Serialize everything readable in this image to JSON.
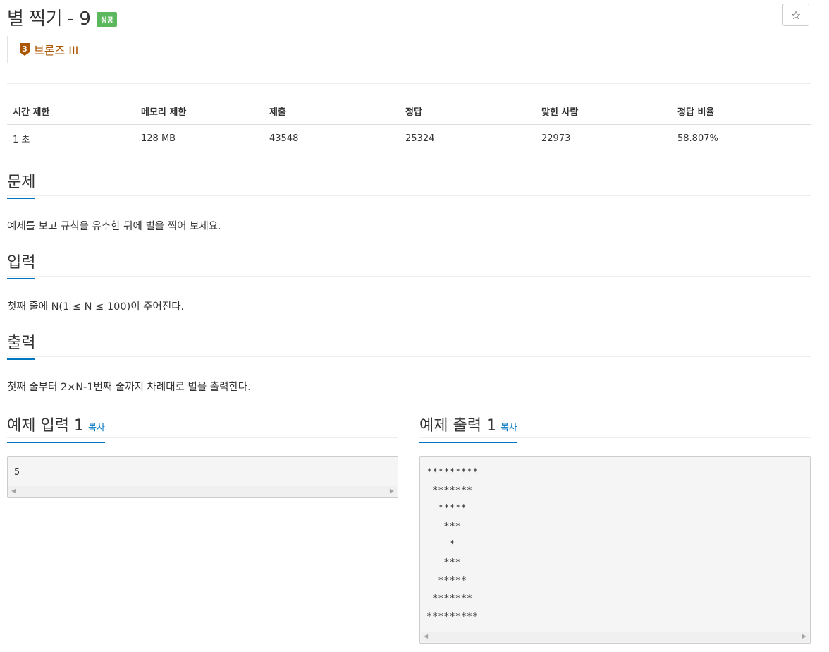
{
  "problem": {
    "title": "별 찍기 - 9",
    "status_badge": "성공",
    "star_glyph": "☆",
    "tier": {
      "number": "3",
      "label": "브론즈 III",
      "color": "#ad5600"
    }
  },
  "info_table": {
    "headers": [
      "시간 제한",
      "메모리 제한",
      "제출",
      "정답",
      "맞힌 사람",
      "정답 비율"
    ],
    "values": [
      "1 초",
      "128 MB",
      "43548",
      "25324",
      "22973",
      "58.807%"
    ]
  },
  "sections": {
    "description": {
      "heading": "문제",
      "body": "예제를 보고 규칙을 유추한 뒤에 별을 찍어 보세요."
    },
    "input": {
      "heading": "입력",
      "body": "첫째 줄에 N(1 ≤ N ≤ 100)이 주어진다."
    },
    "output": {
      "heading": "출력",
      "body": "첫째 줄부터 2×N-1번째 줄까지 차례대로 별을 출력한다."
    }
  },
  "examples": {
    "input": {
      "heading": "예제 입력 1",
      "copy_label": "복사",
      "content": "5"
    },
    "output": {
      "heading": "예제 출력 1",
      "copy_label": "복사",
      "content": "*********\n *******\n  *****\n   ***\n    *\n   ***\n  *****\n *******\n*********"
    }
  },
  "colors": {
    "accent": "#0076c0",
    "success": "#5cb85c",
    "bronze": "#ad5600"
  }
}
